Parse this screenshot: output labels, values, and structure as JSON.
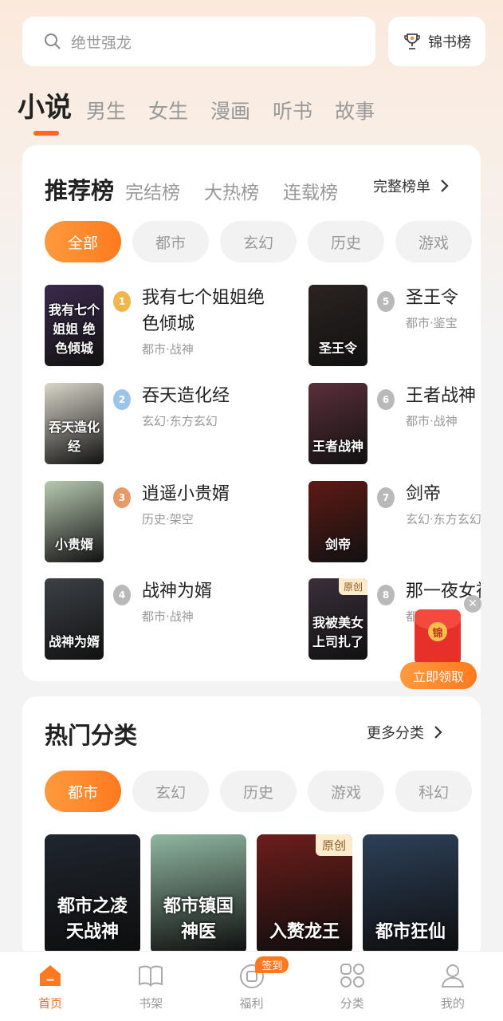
{
  "search": {
    "placeholder": "绝世强龙",
    "rank_button": "锦书榜"
  },
  "top_tabs": [
    "小说",
    "男生",
    "女生",
    "漫画",
    "听书",
    "故事"
  ],
  "rank": {
    "tabs": [
      "推荐榜",
      "完结榜",
      "大热榜",
      "连载榜"
    ],
    "full_list": "完整榜单",
    "chips": [
      "全部",
      "都市",
      "玄幻",
      "历史",
      "游戏"
    ],
    "books": [
      {
        "rank": "1",
        "title": "我有七个姐姐绝色倾城",
        "tag": "都市·战神",
        "cover_text": "我有七个姐姐 绝色倾城",
        "cover_color": "#3b2a4d"
      },
      {
        "rank": "2",
        "title": "吞天造化经",
        "tag": "玄幻·东方玄幻",
        "cover_text": "吞天造化经",
        "cover_color": "#d9d6c9"
      },
      {
        "rank": "3",
        "title": "逍遥小贵婿",
        "tag": "历史·架空",
        "cover_text": "小贵婿",
        "cover_color": "#b7c9b0"
      },
      {
        "rank": "4",
        "title": "战神为婿",
        "tag": "都市·战神",
        "cover_text": "战神为婿",
        "cover_color": "#3c4147"
      },
      {
        "rank": "5",
        "title": "圣王令",
        "tag": "都市·鉴宝",
        "cover_text": "圣王令",
        "cover_color": "#2b2320"
      },
      {
        "rank": "6",
        "title": "王者战神",
        "tag": "都市·战神",
        "cover_text": "王者战神",
        "cover_color": "#5a2f3a"
      },
      {
        "rank": "7",
        "title": "剑帝",
        "tag": "玄幻·东方玄幻",
        "cover_text": "剑帝",
        "cover_color": "#5e1a14"
      },
      {
        "rank": "8",
        "title": "那一夜女神扎",
        "tag": "都市",
        "cover_text": "我被美女上司扎了",
        "cover_color": "#3a2f3a",
        "badge": "原创"
      }
    ]
  },
  "red_packet": {
    "icon_text": "锦",
    "label": "立即领取"
  },
  "hot": {
    "title": "热门分类",
    "more": "更多分类",
    "chips": [
      "都市",
      "玄幻",
      "历史",
      "游戏",
      "科幻"
    ],
    "covers": [
      {
        "text": "都市之凌天战神",
        "color": "#1f262e"
      },
      {
        "text": "都市镇国神医",
        "color": "#8fb6a0"
      },
      {
        "text": "入赘龙王",
        "color": "#6b1e1a",
        "badge": "原创"
      },
      {
        "text": "都市狂仙",
        "color": "#2d4058"
      }
    ]
  },
  "nav": [
    {
      "label": "首页",
      "icon": "home-icon"
    },
    {
      "label": "书架",
      "icon": "bookshelf-icon"
    },
    {
      "label": "福利",
      "icon": "gift-icon",
      "badge": "签到"
    },
    {
      "label": "分类",
      "icon": "category-icon"
    },
    {
      "label": "我的",
      "icon": "profile-icon"
    }
  ],
  "colors": {
    "accent": "#ff7a1e",
    "gold": "#f0b64a",
    "silver": "#b9b9b9",
    "bronze": "#e69a6a"
  }
}
